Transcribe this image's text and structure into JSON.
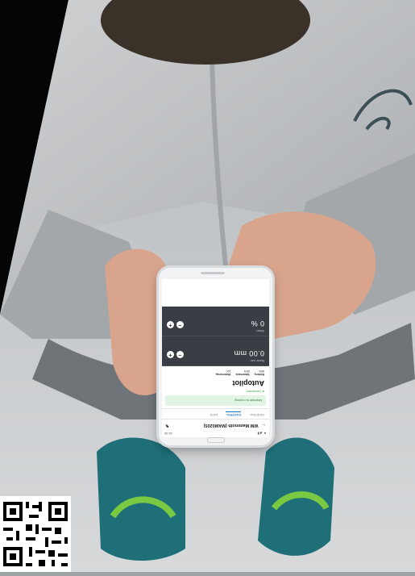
{
  "app": {
    "status_time": "12:32",
    "title": "WM Mammoth (MAM0205)",
    "tabs": [
      "GENERAL",
      "CONTROL",
      "DATA"
    ],
    "active_tab": "CONTROL",
    "banner": "Machine is running",
    "connection": "Connected",
    "heading": "Autopilot",
    "stats": [
      {
        "label": "Battery",
        "value": "89%"
      },
      {
        "label": "Watertank",
        "value": "89%"
      },
      {
        "label": "Watertemp.",
        "value": "10C"
      }
    ],
    "controls": [
      {
        "label": "Blade size",
        "value": "0.00 mm"
      },
      {
        "label": "Water",
        "value": "0 %"
      }
    ]
  },
  "icons": [
    "back-arrow-icon",
    "edit-icon",
    "plus-icon",
    "minus-icon"
  ],
  "colors": {
    "dark_panel": "#3a3e44",
    "accent": "#1f6fb8",
    "success": "#2e7d32"
  }
}
